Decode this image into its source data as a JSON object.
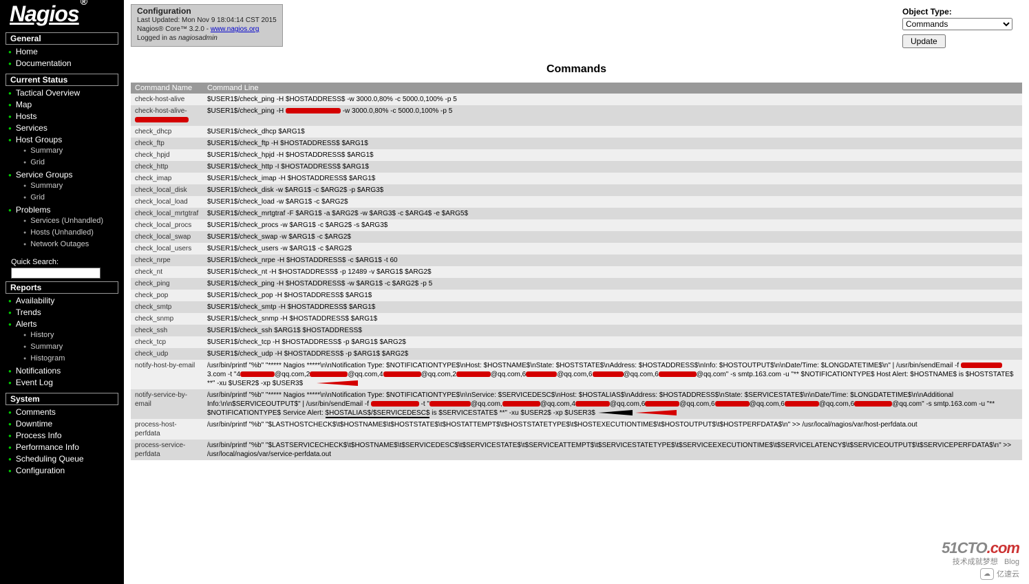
{
  "logo": {
    "text": "Nagios",
    "reg": "®"
  },
  "nav": {
    "sections": [
      {
        "title": "General",
        "items": [
          {
            "label": "Home",
            "type": "green"
          },
          {
            "label": "Documentation",
            "type": "green"
          }
        ]
      },
      {
        "title": "Current Status",
        "items": [
          {
            "label": "Tactical Overview",
            "type": "green"
          },
          {
            "label": "Map",
            "type": "green"
          },
          {
            "label": "Hosts",
            "type": "green"
          },
          {
            "label": "Services",
            "type": "green"
          },
          {
            "label": "Host Groups",
            "type": "green",
            "children": [
              {
                "label": "Summary",
                "type": "gray"
              },
              {
                "label": "Grid",
                "type": "gray"
              }
            ]
          },
          {
            "label": "Service Groups",
            "type": "green",
            "children": [
              {
                "label": "Summary",
                "type": "gray"
              },
              {
                "label": "Grid",
                "type": "gray"
              }
            ]
          },
          {
            "label": "Problems",
            "type": "green",
            "children": [
              {
                "label": "Services (Unhandled)",
                "type": "gray"
              },
              {
                "label": "Hosts (Unhandled)",
                "type": "gray"
              },
              {
                "label": "Network Outages",
                "type": "gray"
              }
            ]
          }
        ],
        "quick_search_label": "Quick Search:"
      },
      {
        "title": "Reports",
        "items": [
          {
            "label": "Availability",
            "type": "green"
          },
          {
            "label": "Trends",
            "type": "green"
          },
          {
            "label": "Alerts",
            "type": "green",
            "children": [
              {
                "label": "History",
                "type": "gray"
              },
              {
                "label": "Summary",
                "type": "gray"
              },
              {
                "label": "Histogram",
                "type": "gray"
              }
            ]
          },
          {
            "label": "Notifications",
            "type": "green"
          },
          {
            "label": "Event Log",
            "type": "green"
          }
        ]
      },
      {
        "title": "System",
        "items": [
          {
            "label": "Comments",
            "type": "green"
          },
          {
            "label": "Downtime",
            "type": "green"
          },
          {
            "label": "Process Info",
            "type": "green"
          },
          {
            "label": "Performance Info",
            "type": "green"
          },
          {
            "label": "Scheduling Queue",
            "type": "green"
          },
          {
            "label": "Configuration",
            "type": "green"
          }
        ]
      }
    ]
  },
  "info_box": {
    "title": "Configuration",
    "updated": "Last Updated: Mon Nov 9 18:04:14 CST 2015",
    "version_prefix": "Nagios® Core™ 3.2.0 - ",
    "version_link": "www.nagios.org",
    "logged_prefix": "Logged in as ",
    "logged_user": "nagiosadmin"
  },
  "object_type": {
    "label": "Object Type:",
    "value": "Commands",
    "button": "Update"
  },
  "page_title": "Commands",
  "table": {
    "headers": [
      "Command Name",
      "Command Line"
    ],
    "rows": [
      {
        "name": "check-host-alive",
        "line": "$USER1$/check_ping -H $HOSTADDRESS$ -w 3000.0,80% -c 5000.0,100% -p 5"
      },
      {
        "name": "check-host-alive-",
        "name_redacted": true,
        "line_prefix": "$USER1$/check_ping -H ",
        "line_mid_redact": true,
        "line_suffix": " -w 3000.0,80% -c 5000.0,100% -p 5"
      },
      {
        "name": "check_dhcp",
        "line": "$USER1$/check_dhcp $ARG1$"
      },
      {
        "name": "check_ftp",
        "line": "$USER1$/check_ftp -H $HOSTADDRESS$ $ARG1$"
      },
      {
        "name": "check_hpjd",
        "line": "$USER1$/check_hpjd -H $HOSTADDRESS$ $ARG1$"
      },
      {
        "name": "check_http",
        "line": "$USER1$/check_http -I $HOSTADDRESS$ $ARG1$"
      },
      {
        "name": "check_imap",
        "line": "$USER1$/check_imap -H $HOSTADDRESS$ $ARG1$"
      },
      {
        "name": "check_local_disk",
        "line": "$USER1$/check_disk -w $ARG1$ -c $ARG2$ -p $ARG3$"
      },
      {
        "name": "check_local_load",
        "line": "$USER1$/check_load -w $ARG1$ -c $ARG2$"
      },
      {
        "name": "check_local_mrtgtraf",
        "line": "$USER1$/check_mrtgtraf -F $ARG1$ -a $ARG2$ -w $ARG3$ -c $ARG4$ -e $ARG5$"
      },
      {
        "name": "check_local_procs",
        "line": "$USER1$/check_procs -w $ARG1$ -c $ARG2$ -s $ARG3$"
      },
      {
        "name": "check_local_swap",
        "line": "$USER1$/check_swap -w $ARG1$ -c $ARG2$"
      },
      {
        "name": "check_local_users",
        "line": "$USER1$/check_users -w $ARG1$ -c $ARG2$"
      },
      {
        "name": "check_nrpe",
        "line": "$USER1$/check_nrpe -H $HOSTADDRESS$ -c $ARG1$ -t 60"
      },
      {
        "name": "check_nt",
        "line": "$USER1$/check_nt -H $HOSTADDRESS$ -p 12489 -v $ARG1$ $ARG2$"
      },
      {
        "name": "check_ping",
        "line": "$USER1$/check_ping -H $HOSTADDRESS$ -w $ARG1$ -c $ARG2$ -p 5"
      },
      {
        "name": "check_pop",
        "line": "$USER1$/check_pop -H $HOSTADDRESS$ $ARG1$"
      },
      {
        "name": "check_smtp",
        "line": "$USER1$/check_smtp -H $HOSTADDRESS$ $ARG1$"
      },
      {
        "name": "check_snmp",
        "line": "$USER1$/check_snmp -H $HOSTADDRESS$ $ARG1$"
      },
      {
        "name": "check_ssh",
        "line": "$USER1$/check_ssh $ARG1$ $HOSTADDRESS$"
      },
      {
        "name": "check_tcp",
        "line": "$USER1$/check_tcp -H $HOSTADDRESS$ -p $ARG1$ $ARG2$"
      },
      {
        "name": "check_udp",
        "line": "$USER1$/check_udp -H $HOSTADDRESS$ -p $ARG1$ $ARG2$"
      }
    ],
    "notify_host": {
      "name": "notify-host-by-email",
      "line_parts": {
        "a": "/usr/bin/printf \"%b\" \"***** Nagios *****\\n\\nNotification Type: $NOTIFICATIONTYPE$\\nHost: $HOSTNAME$\\nState: $HOSTSTATE$\\nAddress: $HOSTADDRESS$\\nInfo: $HOSTOUTPUT$\\n\\nDate/Time: $LONGDATETIME$\\n\" | /usr/bin/sendEmail -f ",
        "b": "3.com -t \"4",
        "c": "@qq.com,2",
        "d": "@qq.com,4",
        "e": "@qq.com,2",
        "f": "@qq.com,6",
        "g": "@qq.com,6",
        "h": "@qq.com,6",
        "i": "@qq.com\" -s smtp.163.com -u \"** $NOTIFICATIONTYPE$ Host Alert: $HOSTNAME$ is $HOSTSTATE$ **\" -xu $USER2$ -xp $USER3$"
      }
    },
    "notify_service": {
      "name": "notify-service-by-email",
      "line_parts": {
        "a": "/usr/bin/printf \"%b\" \"***** Nagios *****\\n\\nNotification Type: $NOTIFICATIONTYPE$\\n\\nService: $SERVICEDESC$\\nHost: $HOSTALIAS$\\nAddress: $HOSTADDRESS$\\nState: $SERVICESTATE$\\n\\nDate/Time: $LONGDATETIME$\\n\\nAdditional Info:\\n\\n$SERVICEOUTPUT$\" | /usr/bin/sendEmail -f ",
        "b": " -t \"",
        "c": "@qq.com,",
        "d": "@qq.com,4",
        "e": "@qq.com,6",
        "f": "@qq.com,6",
        "g": "@qq.com,6",
        "h": "@qq.com,6",
        "i": "@qq.com\" -s smtp.163.com -u \"** $NOTIFICATIONTYPE$ Service Alert: $HOSTALIAS$/$SERVICEDESC$ is $SERVICESTATE$ **\" -xu $USER2$ -xp $USER3$"
      }
    },
    "process_host": {
      "name": "process-host-perfdata",
      "line": "/usr/bin/printf \"%b\" \"$LASTHOSTCHECK$\\t$HOSTNAME$\\t$HOSTSTATE$\\t$HOSTATTEMPT$\\t$HOSTSTATETYPE$\\t$HOSTEXECUTIONTIME$\\t$HOSTOUTPUT$\\t$HOSTPERFDATA$\\n\" >> /usr/local/nagios/var/host-perfdata.out"
    },
    "process_service": {
      "name": "process-service-perfdata",
      "line": "/usr/bin/printf \"%b\" \"$LASTSERVICECHECK$\\t$HOSTNAME$\\t$SERVICEDESC$\\t$SERVICESTATE$\\t$SERVICEATTEMPT$\\t$SERVICESTATETYPE$\\t$SERVICEEXECUTIONTIME$\\t$SERVICELATENCY$\\t$SERVICEOUTPUT$\\t$SERVICEPERFDATA$\\n\" >> /usr/local/nagios/var/service-perfdata.out"
    }
  },
  "watermark": {
    "main_a": "51CTO",
    "main_b": ".com",
    "sub_a": "技术成就梦想",
    "sub_b": "Blog",
    "cloud": "亿速云"
  }
}
